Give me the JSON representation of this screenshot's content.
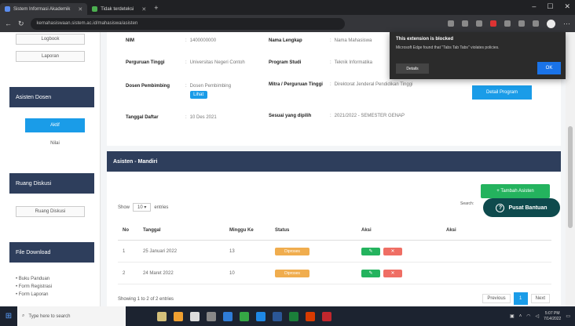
{
  "browser": {
    "tabs": [
      {
        "label": "Sistem Informasi Akademik",
        "active": true
      },
      {
        "label": "Tidak terdeteksi",
        "active": false
      }
    ],
    "url": "kemahasiswaan.sistem.ac.id/mahasiswa/asisten"
  },
  "sidebar": {
    "btn_top_1": "Logbook",
    "btn_top_2": "Laporan",
    "asisten_head": "Asisten Dosen",
    "asisten_active": "Aktif",
    "asisten_sub": "Nilai",
    "ruang_head": "Ruang Diskusi",
    "ruang_btn": "Ruang Diskusi",
    "file_head": "File Download",
    "file_items": [
      "• Buku Panduan",
      "• Form Registrasi",
      "• Form Laporan"
    ]
  },
  "info": {
    "nim_label": "NIM",
    "nim_value": "1400000000",
    "nama_label": "Nama Lengkap",
    "nama_value": "Nama Mahasiswa",
    "pt_label": "Perguruan Tinggi",
    "pt_value": "Universitas Negeri Contoh",
    "prodi_label": "Program Studi",
    "prodi_value": "Teknik Informatika",
    "dosen_label": "Dosen Pembimbing",
    "dosen_value": "Dosen Pembimbing",
    "dosen_btn": "Lihat",
    "mitra_label": "Mitra / Perguruan Tinggi",
    "mitra_value": "Direktorat Jenderal Pendidikan Tinggi",
    "tgl_label": "Tanggal Daftar",
    "tgl_value": "10 Des 2021",
    "sesuai_label": "Sesuai yang dipilih",
    "sesuai_value": "2021/2022 - SEMESTER GENAP",
    "right_btn": "Detail Program"
  },
  "section": {
    "title": "Asisten - Mandiri",
    "add_btn": "+ Tambah Asisten",
    "show_label": "Show",
    "show_value": "10",
    "entries_label": "entries",
    "search_label": "Search:",
    "columns": [
      "No",
      "Tanggal",
      "Minggu Ke",
      "Status",
      "Aksi",
      "Aksi"
    ],
    "rows": [
      {
        "no": "1",
        "tanggal": "25 Januari 2022",
        "minggu": "13",
        "status": "Diproses",
        "aksi_a": "✎",
        "aksi_b": "✕"
      },
      {
        "no": "2",
        "tanggal": "24 Maret 2022",
        "minggu": "10",
        "status": "Diproses",
        "aksi_a": "✎",
        "aksi_b": "✕"
      }
    ],
    "footer_info": "Showing 1 to 2 of 2 entries",
    "prev": "Previous",
    "page": "1",
    "next": "Next"
  },
  "popup": {
    "title": "This extension is blocked",
    "message": "Microsoft Edge found that \"Tabs Tab Tabs\" violates policies.",
    "left_btn": "Details",
    "ok": "OK"
  },
  "help": {
    "label": "Pusat Bantuan"
  },
  "taskbar": {
    "search_placeholder": "Type here to search",
    "time": "5:07 PM",
    "date": "7/14/2022"
  },
  "colors": {
    "primary": "#1a9ce8",
    "dark_header": "#2e3e5c",
    "success": "#24b35e",
    "warning": "#f0ad4e",
    "danger": "#ef6e64",
    "help": "#0e4a4d"
  }
}
